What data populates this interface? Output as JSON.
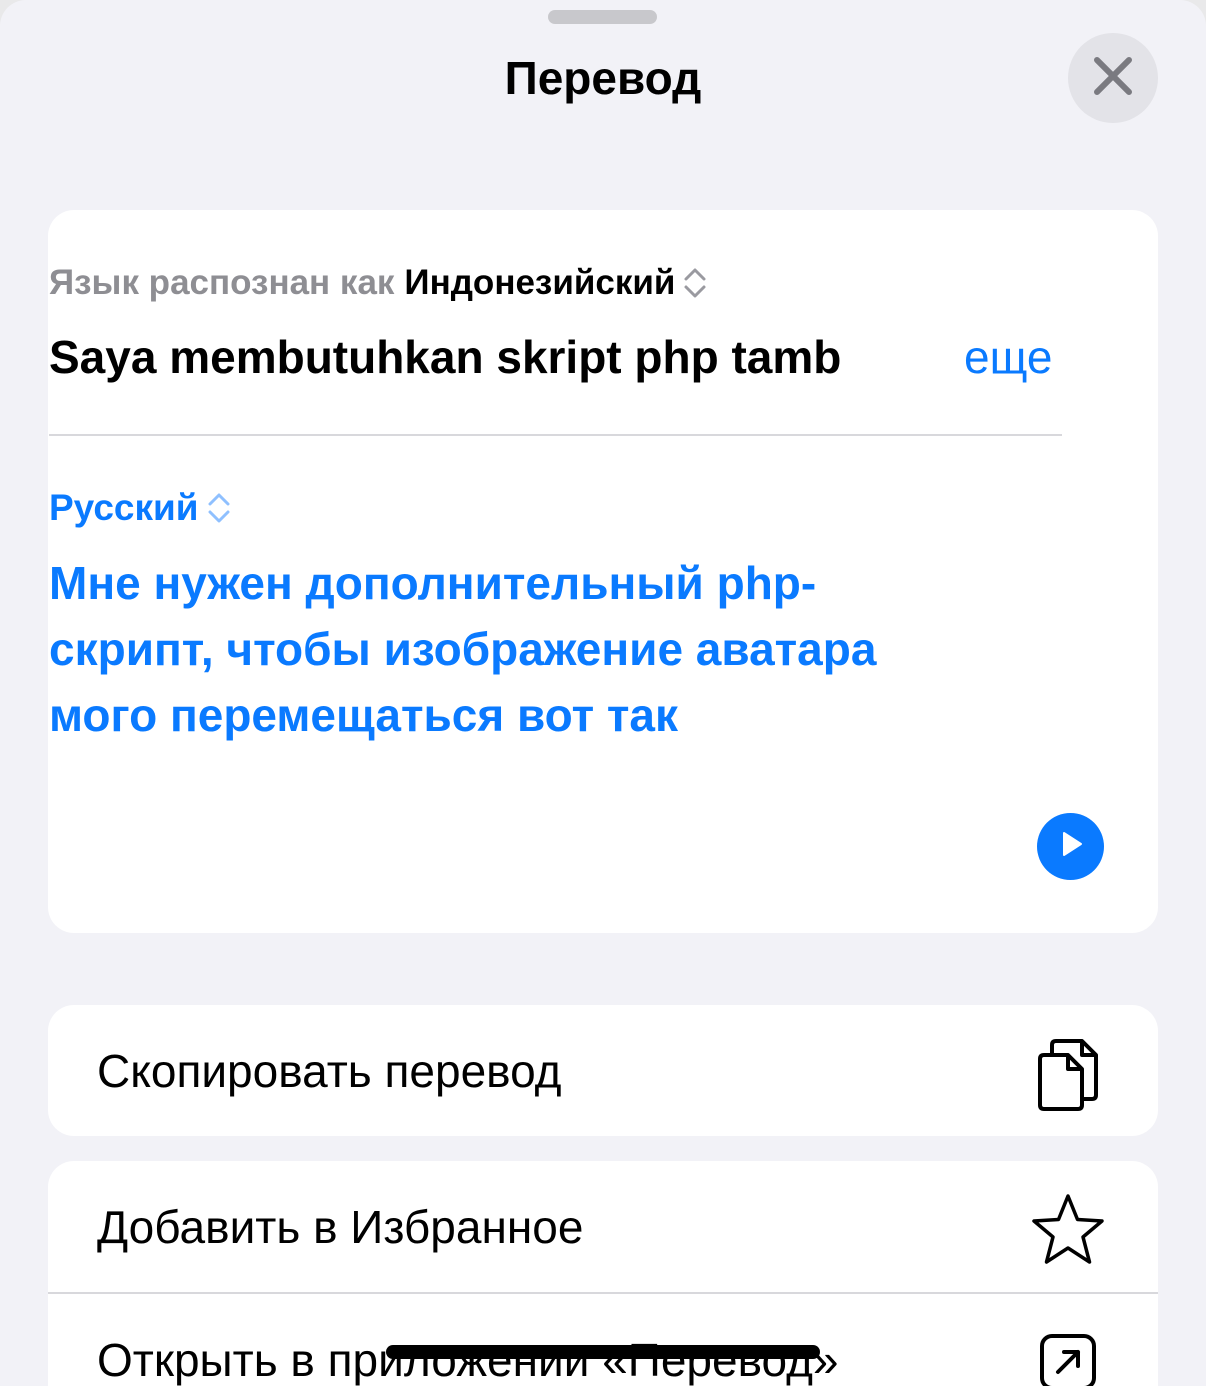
{
  "sheet": {
    "title": "Перевод"
  },
  "source": {
    "detected_prefix": "Язык распознан как",
    "detected_language": "Индонезийский",
    "text": "Saya membutuhkan skript php tamb",
    "more_label": "еще"
  },
  "target": {
    "language": "Русский",
    "text": "Мне нужен дополнительный php-скрипт, чтобы изображение аватара мого перемещаться вот так"
  },
  "actions": {
    "copy_label": "Скопировать перевод",
    "favorite_label": "Добавить в Избранное",
    "open_app_label": "Открыть в приложении «Перевод»"
  },
  "colors": {
    "accent": "#0a7aff",
    "secondary_text": "#8e8e93",
    "background": "#f2f2f7"
  },
  "icons": {
    "close": "close-icon",
    "chevron_updown": "chevron-updown-icon",
    "play": "play-icon",
    "copy": "copy-icon",
    "star": "star-icon",
    "open_external": "arrow-up-right-square-icon"
  }
}
